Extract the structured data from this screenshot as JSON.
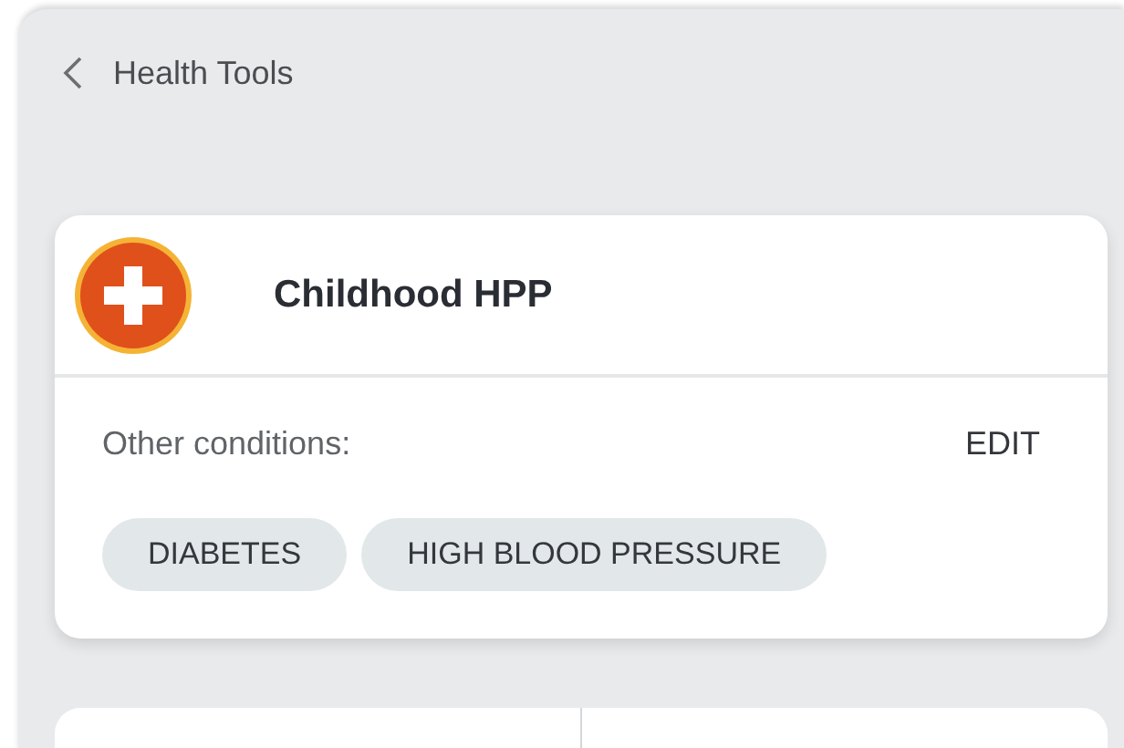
{
  "header": {
    "title": "Health Tools"
  },
  "condition_card": {
    "title": "Childhood HPP",
    "other_label": "Other conditions:",
    "edit_label": "EDIT",
    "tags": [
      "DIABETES",
      "HIGH BLOOD PRESSURE"
    ]
  }
}
